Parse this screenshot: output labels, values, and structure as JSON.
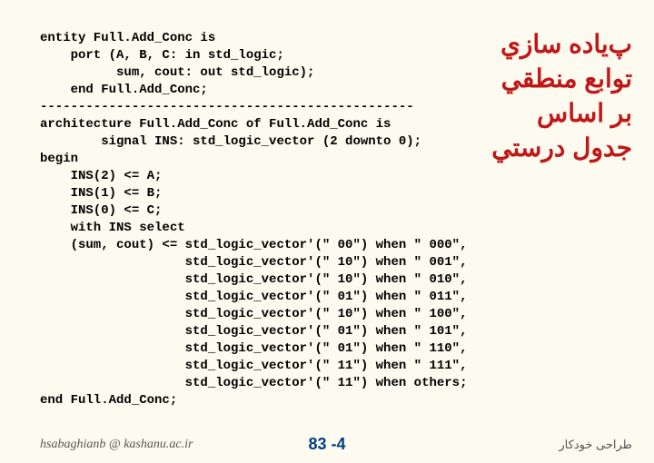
{
  "code": {
    "l1": "entity Full.Add_Conc is",
    "l2": "    port (A, B, C: in std_logic;",
    "l3": "          sum, cout: out std_logic);",
    "l4": "    end Full.Add_Conc;",
    "l5": "-------------------------------------------------",
    "l6": "architecture Full.Add_Conc of Full.Add_Conc is",
    "l7": "        signal INS: std_logic_vector (2 downto 0);",
    "l8": "begin",
    "l9": "    INS(2) <= A;",
    "l10": "    INS(1) <= B;",
    "l11": "    INS(0) <= C;",
    "l12": "    with INS select",
    "l13": "    (sum, cout) <= std_logic_vector'(\" 00\") when \" 000\",",
    "l14": "                   std_logic_vector'(\" 10\") when \" 001\",",
    "l15": "                   std_logic_vector'(\" 10\") when \" 010\",",
    "l16": "                   std_logic_vector'(\" 01\") when \" 011\",",
    "l17": "                   std_logic_vector'(\" 10\") when \" 100\",",
    "l18": "                   std_logic_vector'(\" 01\") when \" 101\",",
    "l19": "                   std_logic_vector'(\" 01\") when \" 110\",",
    "l20": "                   std_logic_vector'(\" 11\") when \" 111\",",
    "l21": "                   std_logic_vector'(\" 11\") when others;",
    "l22": "end Full.Add_Conc;"
  },
  "persian": {
    "l1": "پ‌ياده سازي",
    "l2": "توابع منطقي",
    "l3": "بر اساس",
    "l4": "جدول درستي"
  },
  "footer": {
    "left": "hsabaghianb @ kashanu.ac.ir",
    "center": "83 -4",
    "right": "طراحی خودکار"
  }
}
